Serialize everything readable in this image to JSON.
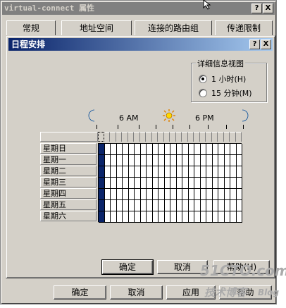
{
  "window": {
    "title": "virtual-connect 属性",
    "help_btn": "?",
    "close_btn": "X"
  },
  "tabs": [
    {
      "label": "常规"
    },
    {
      "label": "地址空间"
    },
    {
      "label": "连接的路由组"
    },
    {
      "label": "传递限制"
    }
  ],
  "schedule_dialog": {
    "title": "日程安排",
    "help_btn": "?",
    "close_btn": "X",
    "detail_view": {
      "label": "详细信息视图",
      "options": [
        {
          "label": "1 小时(H)",
          "checked": true
        },
        {
          "label": "15 分钟(M)",
          "checked": false
        }
      ]
    },
    "timeline": {
      "six_am": "6 AM",
      "six_pm": "6 PM"
    },
    "days": [
      "星期日",
      "星期一",
      "星期二",
      "星期三",
      "星期四",
      "星期五",
      "星期六"
    ],
    "ok_btn": "确定",
    "cancel_btn": "取消",
    "help_btn2": "帮助(H)"
  },
  "bottom_buttons": {
    "ok": "确定",
    "cancel": "取消",
    "apply": "应用",
    "help": "帮助"
  },
  "watermark": {
    "line1": "51CTO.com",
    "line2": "技术博客",
    "line3": "Blog"
  },
  "colors": {
    "selected_column": "#0a246a",
    "title_active": "#0a246a"
  }
}
